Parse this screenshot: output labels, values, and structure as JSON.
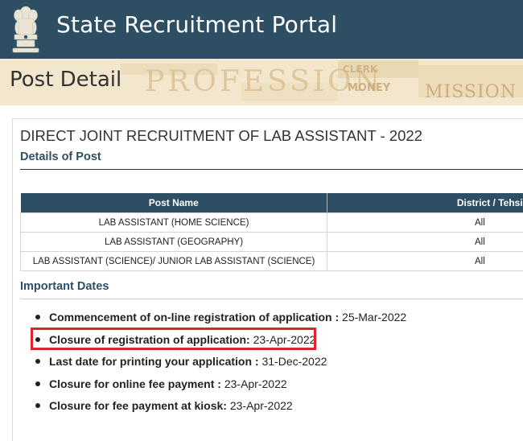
{
  "header": {
    "title": "State Recruitment Portal",
    "emblem_icon": "national-emblem-icon",
    "background": "#2e4f63"
  },
  "banner": {
    "page_title": "Post Detail",
    "background_words": [
      "PROFESSION",
      "CLERK",
      "MONEY",
      "MISSION"
    ]
  },
  "post": {
    "title": "DIRECT JOINT RECRUITMENT OF LAB ASSISTANT - 2022",
    "details_heading": "Details of Post",
    "table": {
      "headers": [
        "Post Name",
        "District / Tehsil"
      ],
      "rows": [
        [
          "LAB ASSISTANT (HOME SCIENCE)",
          "All"
        ],
        [
          "LAB ASSISTANT (GEOGRAPHY)",
          "All"
        ],
        [
          "LAB ASSISTANT (SCIENCE)/ JUNIOR LAB ASSISTANT (SCIENCE)",
          "All"
        ]
      ]
    }
  },
  "important_dates": {
    "heading": "Important Dates",
    "items": [
      {
        "label": "Commencement of on-line registration of application :",
        "value": "25-Mar-2022"
      },
      {
        "label": "Closure of registration of application:",
        "value": "23-Apr-2022",
        "highlighted": true
      },
      {
        "label": "Last date for printing your application :",
        "value": "31-Dec-2022"
      },
      {
        "label": "Closure for online fee payment :",
        "value": "23-Apr-2022"
      },
      {
        "label": "Closure for fee payment at kiosk:",
        "value": "23-Apr-2022"
      }
    ],
    "highlight_color": "#d6262c"
  }
}
